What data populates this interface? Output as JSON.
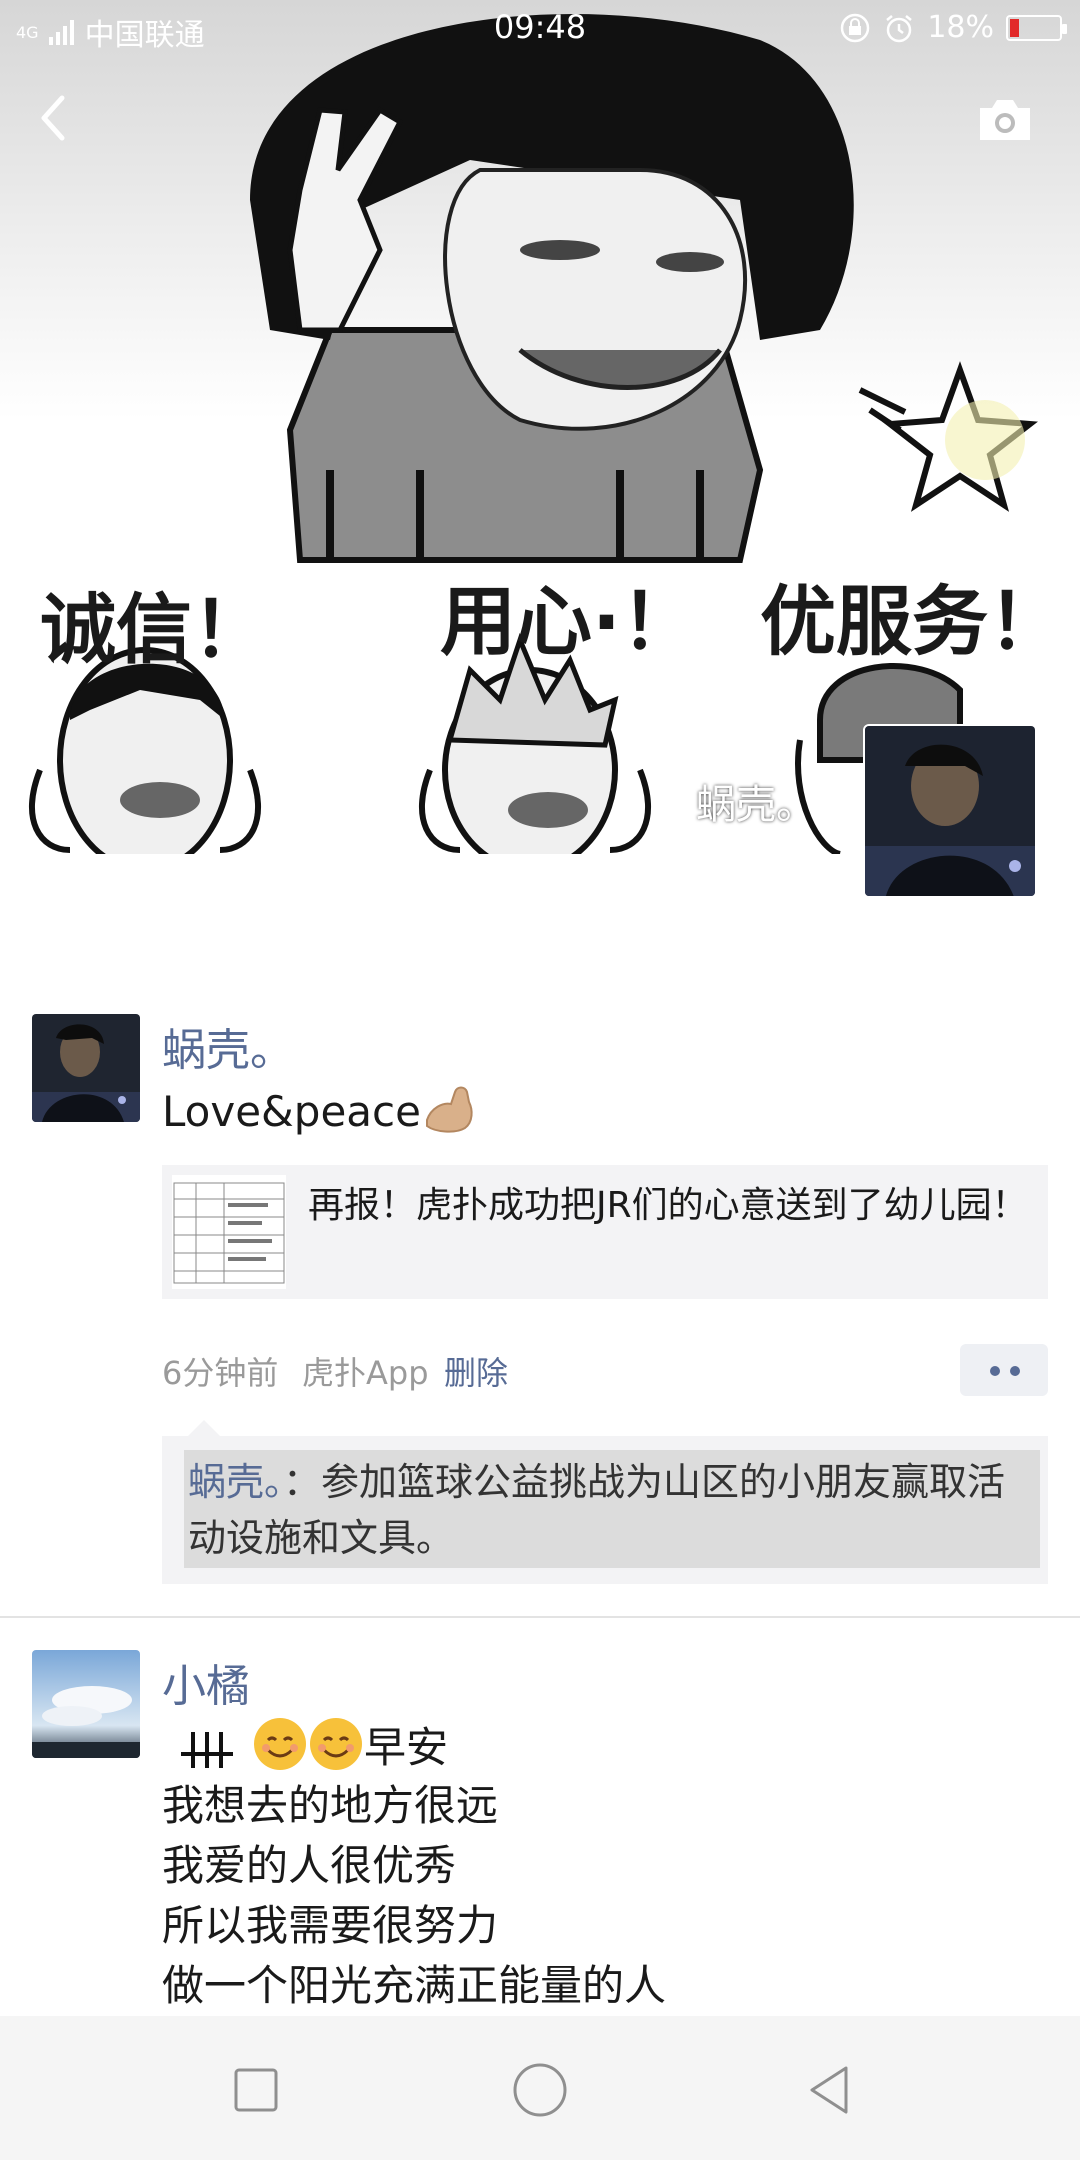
{
  "status_bar": {
    "network": "4G",
    "carrier": "中国联通",
    "time": "09:48",
    "battery": "18%",
    "battery_level": 0.18
  },
  "cover": {
    "captions": [
      "诚信！",
      "用心·！",
      "优服务！"
    ]
  },
  "owner": {
    "name": "蜗壳。"
  },
  "posts": [
    {
      "author": "蜗壳。",
      "text": "Love&peace",
      "link_title": "再报！虎扑成功把JR们的心意送到了幼儿园！",
      "time": "6分钟前",
      "source": "虎扑App",
      "delete_label": "删除",
      "comment": {
        "author": "蜗壳。",
        "separator": "：",
        "text": "参加篮球公益挑战为山区的小朋友赢取活动设施和文具。"
      }
    },
    {
      "author": "小橘",
      "first_line": "早安",
      "lines": [
        "我想去的地方很远",
        "我爱的人很优秀",
        "所以我需要很努力",
        "做一个阳光充满正能量的人"
      ]
    }
  ],
  "icons": {
    "back": "chevron-left-icon",
    "camera": "camera-icon",
    "nav_recents": "square-icon",
    "nav_home": "circle-icon",
    "nav_back": "triangle-back-icon"
  },
  "colors": {
    "link_name": "#576b95",
    "battery_low": "#e22a2a",
    "card_bg": "#f3f3f5"
  }
}
